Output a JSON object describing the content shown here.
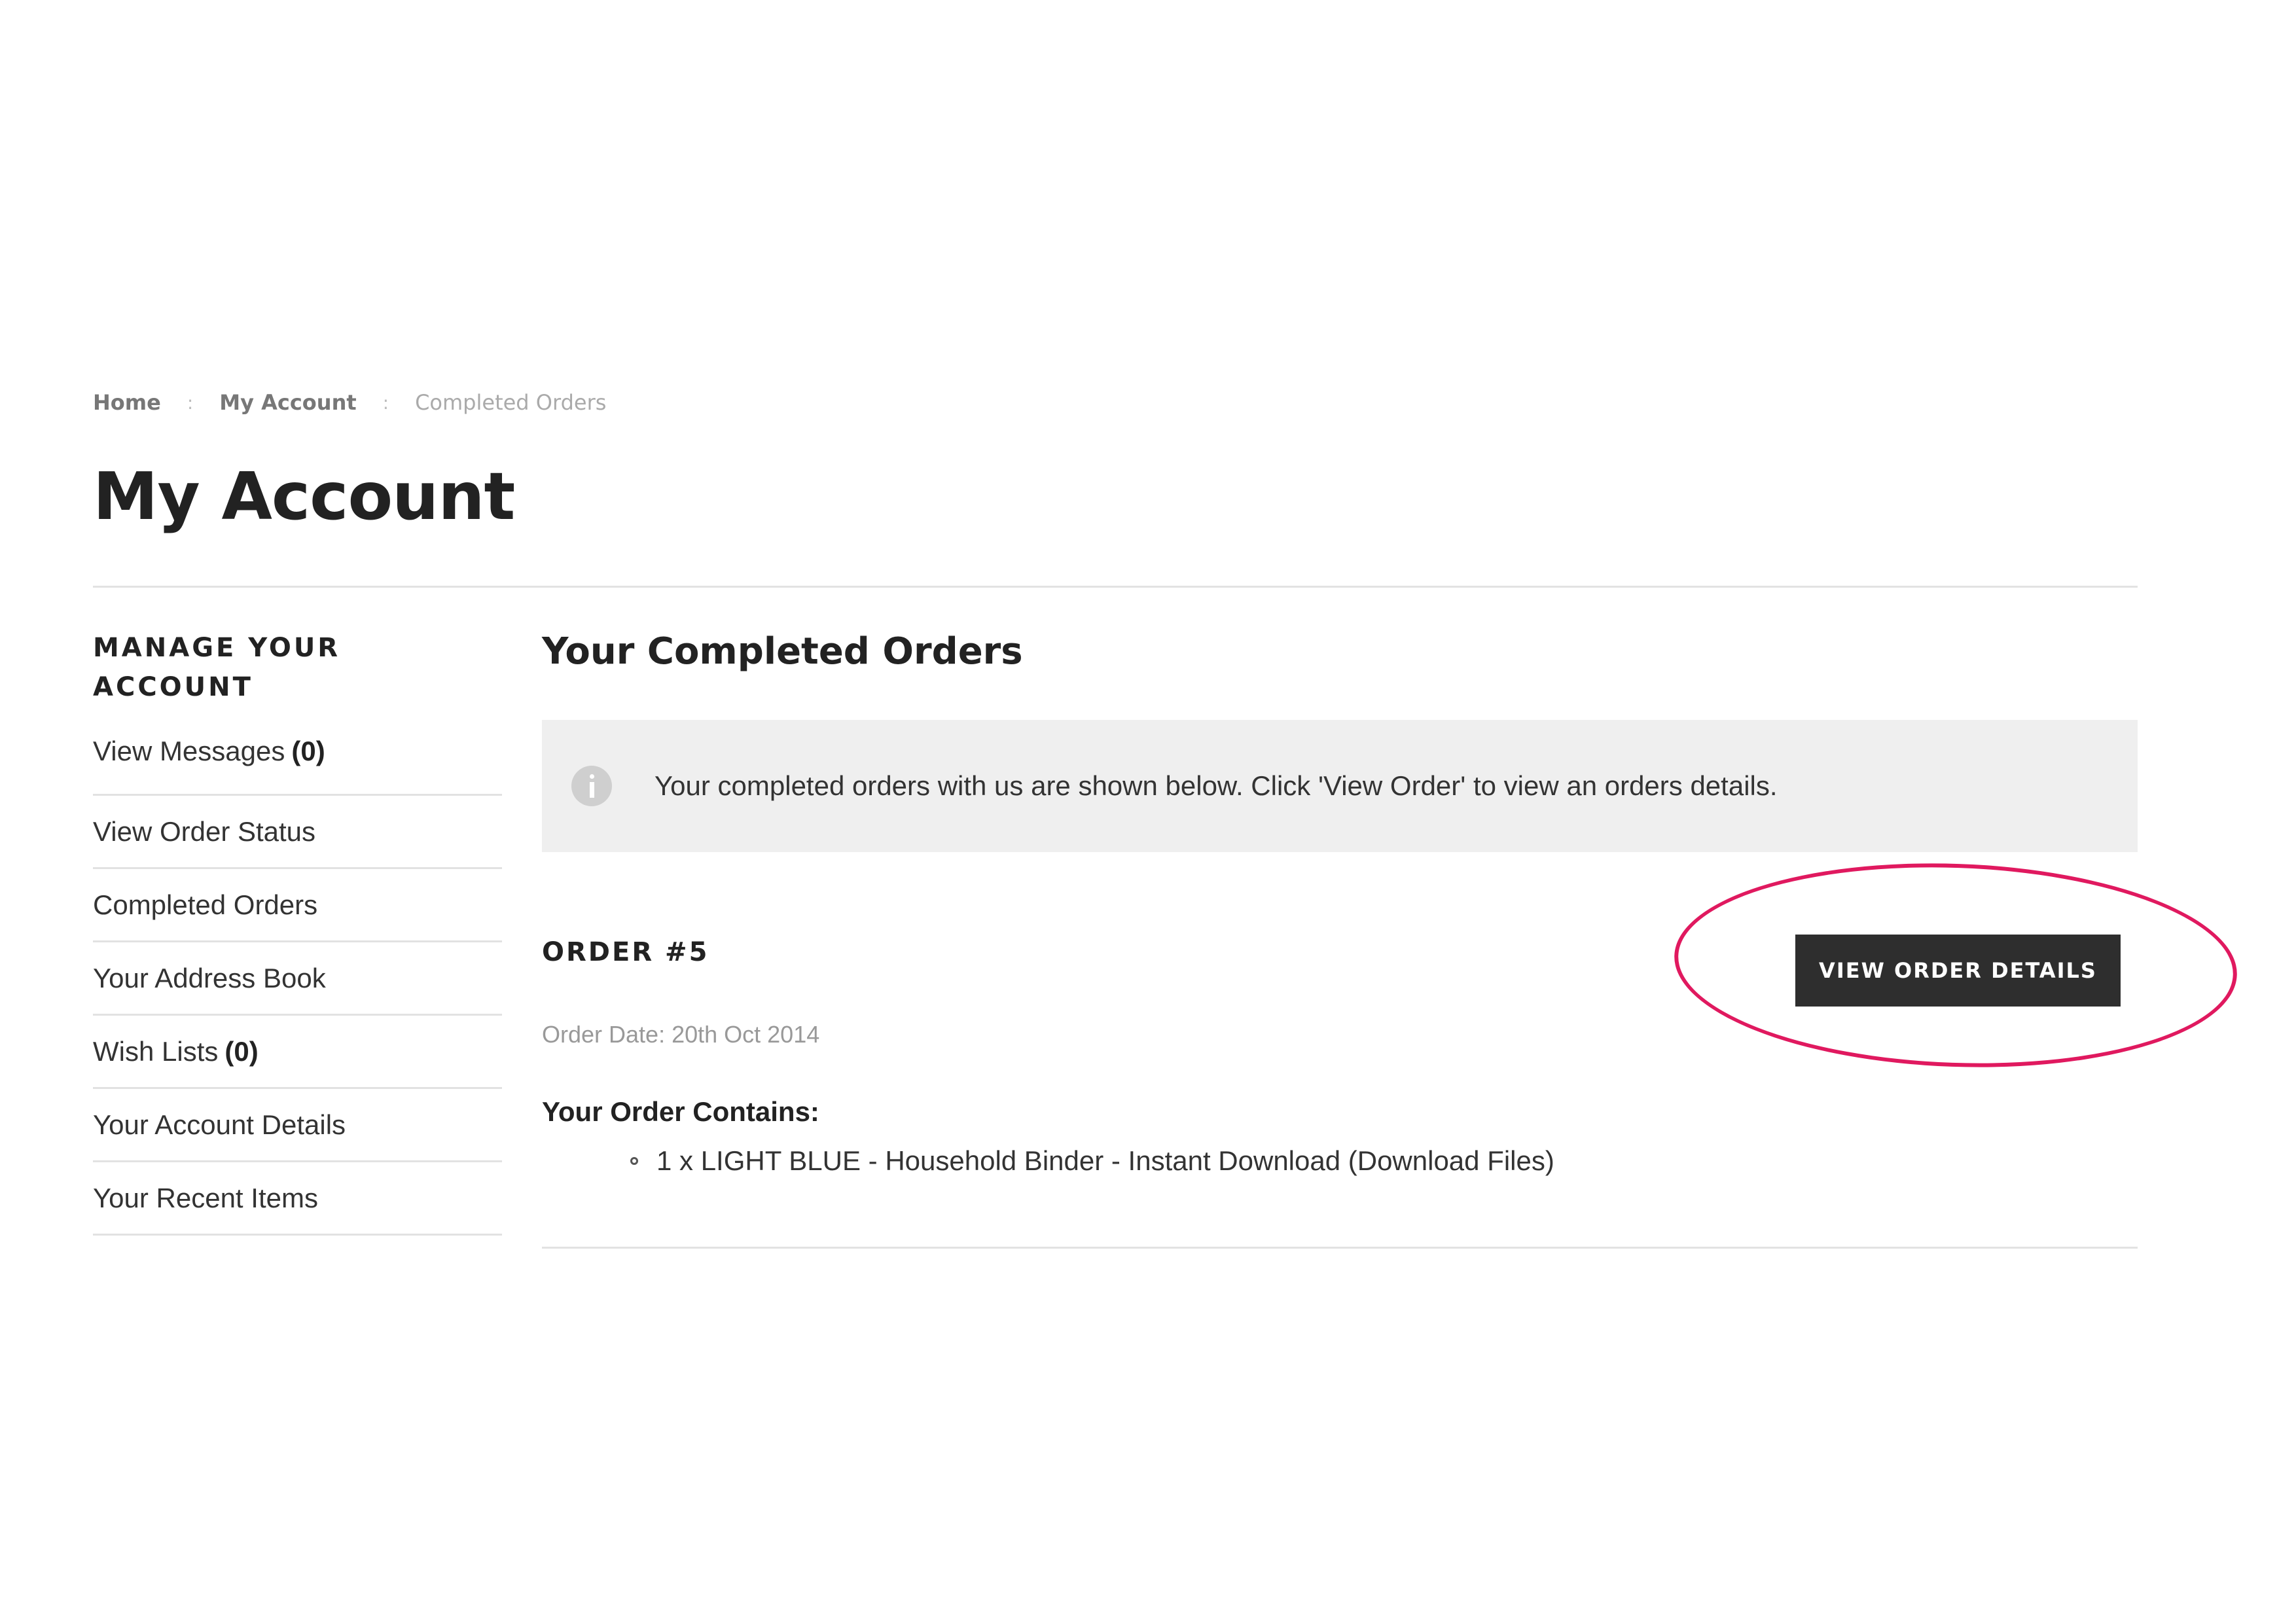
{
  "breadcrumb": {
    "items": [
      "Home",
      "My Account",
      "Completed Orders"
    ],
    "separator": ":"
  },
  "page": {
    "title": "My Account"
  },
  "sidebar": {
    "heading": "MANAGE YOUR ACCOUNT",
    "items": [
      {
        "label": "View Messages",
        "count": "(0)"
      },
      {
        "label": "View Order Status"
      },
      {
        "label": "Completed Orders"
      },
      {
        "label": "Your Address Book"
      },
      {
        "label": "Wish Lists",
        "count": "(0)"
      },
      {
        "label": "Your Account Details"
      },
      {
        "label": "Your Recent Items"
      }
    ]
  },
  "main": {
    "section_title": "Your Completed Orders",
    "info_message": "Your completed orders with us are shown below. Click 'View Order' to view an orders details.",
    "order": {
      "number": "ORDER #5",
      "button_label": "VIEW ORDER DETAILS",
      "date": "Order Date: 20th Oct 2014",
      "contains_label": "Your Order Contains:",
      "items": [
        "1 x LIGHT BLUE - Household Binder - Instant Download (Download Files)"
      ]
    }
  },
  "colors": {
    "button_bg": "#2e2e2e",
    "highlight_ring": "#e0195f",
    "info_box_bg": "#efefef"
  }
}
